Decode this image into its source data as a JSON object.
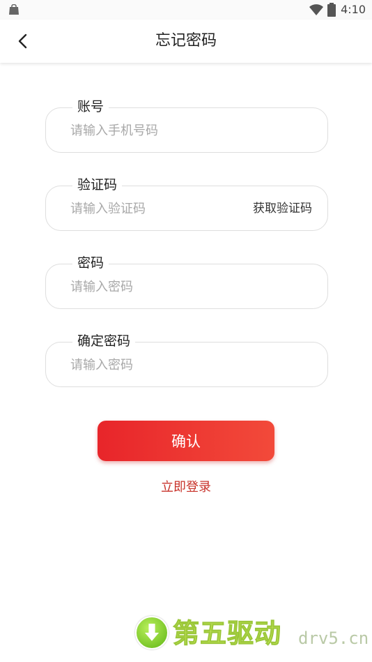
{
  "status_bar": {
    "time": "4:10"
  },
  "nav": {
    "title": "忘记密码"
  },
  "form": {
    "account": {
      "label": "账号",
      "placeholder": "请输入手机号码"
    },
    "code": {
      "label": "验证码",
      "placeholder": "请输入验证码",
      "get_code": "获取验证码"
    },
    "password": {
      "label": "密码",
      "placeholder": "请输入密码"
    },
    "confirm_password": {
      "label": "确定密码",
      "placeholder": "请输入密码"
    }
  },
  "actions": {
    "confirm": "确认",
    "login": "立即登录"
  },
  "watermark": {
    "text": "第五驱动",
    "domain": "drv5.cn"
  },
  "colors": {
    "accent": "#e8252a",
    "link": "#c8322a"
  }
}
